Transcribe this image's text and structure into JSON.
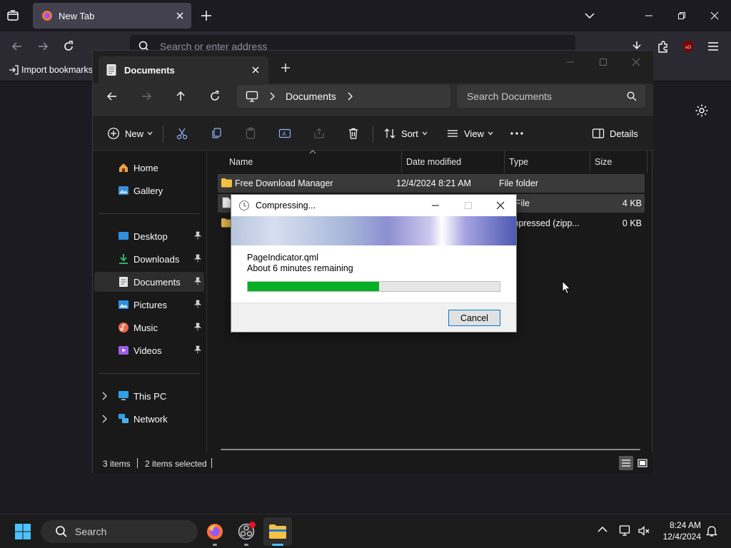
{
  "firefox": {
    "tab_title": "New Tab",
    "url_placeholder": "Search or enter address",
    "bookmark_import": "Import bookmarks...",
    "accent": "#42414d"
  },
  "explorer": {
    "tab_title": "Documents",
    "breadcrumb": "Documents",
    "search_placeholder": "Search Documents",
    "toolbar": {
      "new_label": "New",
      "sort_label": "Sort",
      "view_label": "View",
      "details_label": "Details"
    },
    "nav": {
      "home": "Home",
      "gallery": "Gallery",
      "desktop": "Desktop",
      "downloads": "Downloads",
      "documents": "Documents",
      "pictures": "Pictures",
      "music": "Music",
      "videos": "Videos",
      "this_pc": "This PC",
      "network": "Network"
    },
    "columns": {
      "name": "Name",
      "date": "Date modified",
      "type": "Type",
      "size": "Size"
    },
    "files": [
      {
        "name": "Free Download Manager",
        "date": "12/4/2024 8:21 AM",
        "type": "File folder",
        "size": ""
      },
      {
        "name": "",
        "date": "",
        "type": "S File",
        "size": "4 KB"
      },
      {
        "name": "",
        "date": "",
        "type": "ompressed (zipp...",
        "size": "0 KB"
      }
    ],
    "status": {
      "items": "3 items",
      "selected": "2 items selected"
    }
  },
  "dialog": {
    "title": "Compressing...",
    "filename": "PageIndicator.qml",
    "remaining": "About 6 minutes remaining",
    "progress_percent": 52,
    "cancel_label": "Cancel",
    "progress_color": "#06b025"
  },
  "taskbar": {
    "search_label": "Search",
    "time": "8:24 AM",
    "date": "12/4/2024"
  }
}
